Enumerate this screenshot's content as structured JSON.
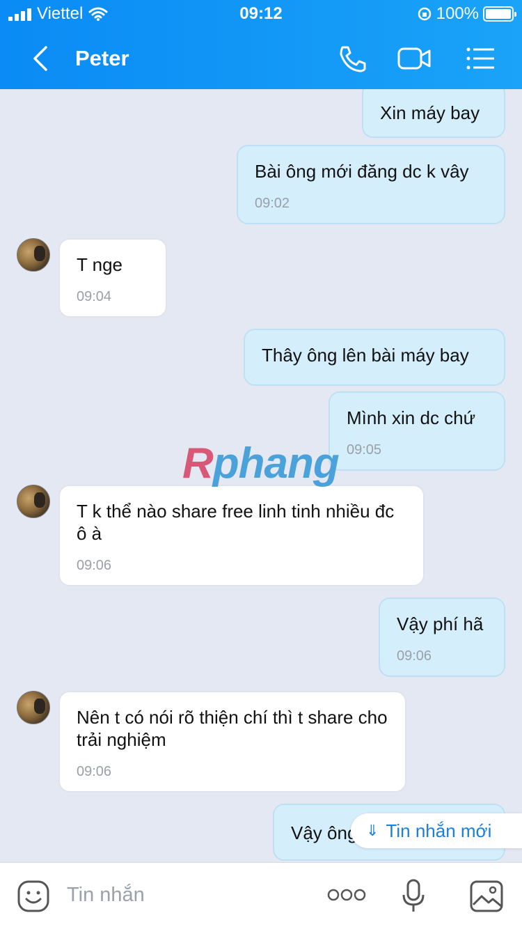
{
  "status": {
    "carrier": "Viettel",
    "time": "09:12",
    "battery": "100%"
  },
  "header": {
    "contact_name": "Peter"
  },
  "messages": [
    {
      "direction": "out",
      "text": "Xin máy bay",
      "time": ""
    },
    {
      "direction": "out",
      "text": "Bài ông mới đăng dc k vây",
      "time": "09:02"
    },
    {
      "direction": "in",
      "text": "T nge",
      "time": "09:04"
    },
    {
      "direction": "out",
      "text": "Thây ông lên bài máy bay",
      "time": ""
    },
    {
      "direction": "out",
      "text": "Mình xin dc chứ",
      "time": "09:05"
    },
    {
      "direction": "in",
      "text": "T k thể nào share free linh tinh nhiều đc ô à",
      "time": "09:06"
    },
    {
      "direction": "out",
      "text": "Vậy phí hã",
      "time": "09:06"
    },
    {
      "direction": "in",
      "text": "Nên t có nói rõ thiện chí thì t share cho trải nghiệm",
      "time": "09:06"
    },
    {
      "direction": "out",
      "text": "Vậy ông",
      "time": ""
    }
  ],
  "watermark": {
    "a": "R",
    "b": "phang"
  },
  "new_message_label": "Tin nhắn mới",
  "input": {
    "placeholder": "Tin nhắn"
  },
  "icons": [
    "back-icon",
    "phone-icon",
    "video-call-icon",
    "menu-icon",
    "sticker-icon",
    "more-icon",
    "microphone-icon",
    "image-icon"
  ]
}
